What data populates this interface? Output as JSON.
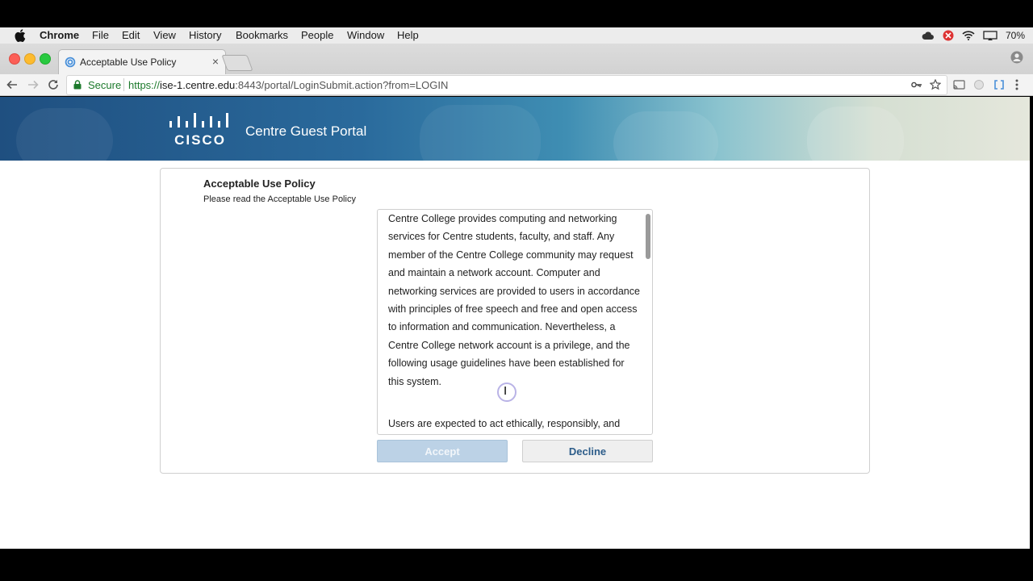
{
  "menubar": {
    "app": "Chrome",
    "items": [
      "File",
      "Edit",
      "View",
      "History",
      "Bookmarks",
      "People",
      "Window",
      "Help"
    ],
    "battery": "70%"
  },
  "tab": {
    "title": "Acceptable Use Policy",
    "close": "×"
  },
  "omnibox": {
    "secure_label": "Secure",
    "url_scheme": "https://",
    "url_host": "ise-1.centre.edu",
    "url_rest": ":8443/portal/LoginSubmit.action?from=LOGIN"
  },
  "portal": {
    "title": "Centre Guest Portal",
    "logo_text": "CISCO"
  },
  "aup": {
    "heading": "Acceptable Use Policy",
    "subheading": "Please read the Acceptable Use Policy",
    "paragraphs": [
      "Centre College provides computing and networking services for Centre students, faculty, and staff. Any member of the Centre College community may request and maintain a network account. Computer and networking services are provided to users in accordance with principles of free speech and free and open access to information and communication. Nevertheless, a Centre College network account is a privilege, and the following usage guidelines have been established for this system.",
      "Users are expected to act ethically, responsibly, and"
    ],
    "accept_label": "Accept",
    "decline_label": "Decline"
  },
  "colors": {
    "banner_start": "#1f4f80",
    "banner_end": "#e5e7dc",
    "accept_disabled_bg": "#bcd2e6",
    "decline_text": "#2d5d8a",
    "secure_green": "#1d7a2c"
  }
}
